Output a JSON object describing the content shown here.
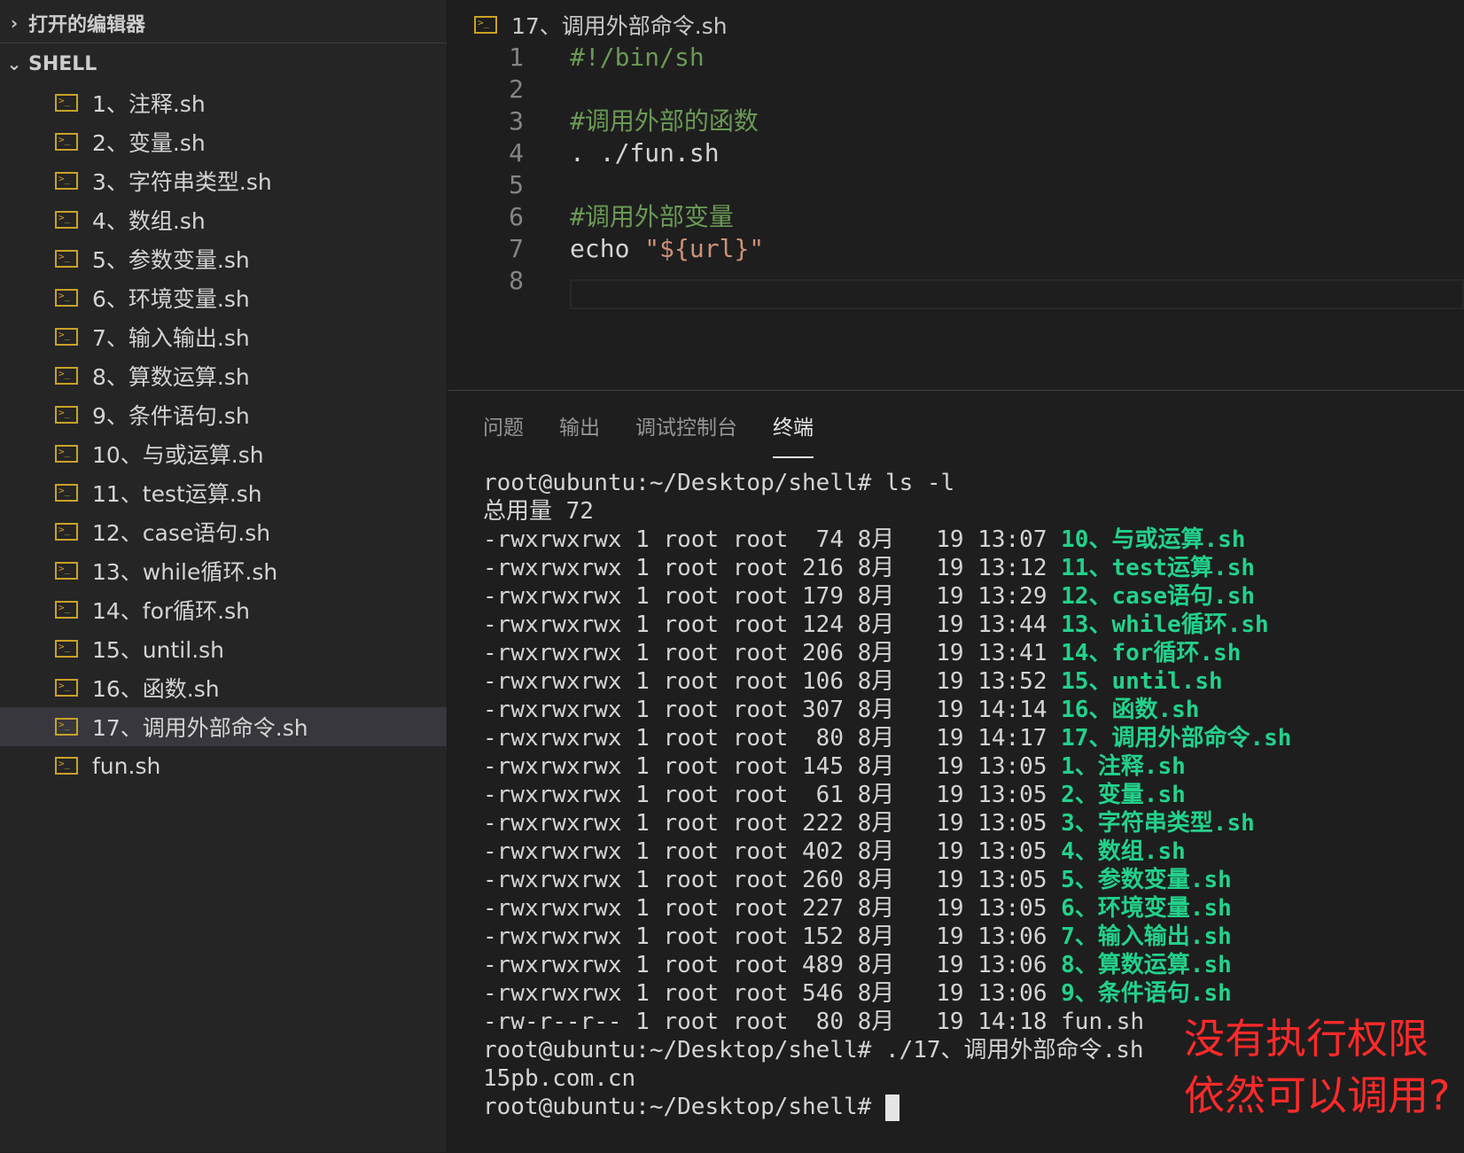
{
  "sidebar": {
    "open_editors_label": "打开的编辑器",
    "folder_label": "SHELL",
    "files": [
      {
        "name": "1、注释.sh"
      },
      {
        "name": "2、变量.sh"
      },
      {
        "name": "3、字符串类型.sh"
      },
      {
        "name": "4、数组.sh"
      },
      {
        "name": "5、参数变量.sh"
      },
      {
        "name": "6、环境变量.sh"
      },
      {
        "name": "7、输入输出.sh"
      },
      {
        "name": "8、算数运算.sh"
      },
      {
        "name": "9、条件语句.sh"
      },
      {
        "name": "10、与或运算.sh"
      },
      {
        "name": "11、test运算.sh"
      },
      {
        "name": "12、case语句.sh"
      },
      {
        "name": "13、while循环.sh"
      },
      {
        "name": "14、for循环.sh"
      },
      {
        "name": "15、until.sh"
      },
      {
        "name": "16、函数.sh"
      },
      {
        "name": "17、调用外部命令.sh",
        "active": true
      },
      {
        "name": "fun.sh"
      }
    ]
  },
  "editor": {
    "breadcrumb": "17、调用外部命令.sh",
    "lines": [
      {
        "num": "1",
        "text": "#!/bin/sh",
        "kind": "cmt"
      },
      {
        "num": "2",
        "text": "",
        "kind": "plain"
      },
      {
        "num": "3",
        "text": "#调用外部的函数",
        "kind": "cmt"
      },
      {
        "num": "4",
        "text": ". ./fun.sh",
        "kind": "plain"
      },
      {
        "num": "5",
        "text": "",
        "kind": "plain"
      },
      {
        "num": "6",
        "text": "#调用外部变量",
        "kind": "cmt"
      },
      {
        "num": "7",
        "text": "echo ",
        "kind": "plain",
        "str": "\"${url}\""
      },
      {
        "num": "8",
        "text": "",
        "kind": "plain"
      }
    ]
  },
  "panel": {
    "tabs": [
      {
        "label": "问题",
        "active": false
      },
      {
        "label": "输出",
        "active": false
      },
      {
        "label": "调试控制台",
        "active": false
      },
      {
        "label": "终端",
        "active": true
      }
    ],
    "terminal": [
      {
        "text": "root@ubuntu:~/Desktop/shell# ls -l",
        "file": ""
      },
      {
        "text": "总用量 72",
        "file": ""
      },
      {
        "text": "-rwxrwxrwx 1 root root  74 8月   19 13:07 ",
        "file": "10、与或运算.sh"
      },
      {
        "text": "-rwxrwxrwx 1 root root 216 8月   19 13:12 ",
        "file": "11、test运算.sh"
      },
      {
        "text": "-rwxrwxrwx 1 root root 179 8月   19 13:29 ",
        "file": "12、case语句.sh"
      },
      {
        "text": "-rwxrwxrwx 1 root root 124 8月   19 13:44 ",
        "file": "13、while循环.sh"
      },
      {
        "text": "-rwxrwxrwx 1 root root 206 8月   19 13:41 ",
        "file": "14、for循环.sh"
      },
      {
        "text": "-rwxrwxrwx 1 root root 106 8月   19 13:52 ",
        "file": "15、until.sh"
      },
      {
        "text": "-rwxrwxrwx 1 root root 307 8月   19 14:14 ",
        "file": "16、函数.sh"
      },
      {
        "text": "-rwxrwxrwx 1 root root  80 8月   19 14:17 ",
        "file": "17、调用外部命令.sh"
      },
      {
        "text": "-rwxrwxrwx 1 root root 145 8月   19 13:05 ",
        "file": "1、注释.sh"
      },
      {
        "text": "-rwxrwxrwx 1 root root  61 8月   19 13:05 ",
        "file": "2、变量.sh"
      },
      {
        "text": "-rwxrwxrwx 1 root root 222 8月   19 13:05 ",
        "file": "3、字符串类型.sh"
      },
      {
        "text": "-rwxrwxrwx 1 root root 402 8月   19 13:05 ",
        "file": "4、数组.sh"
      },
      {
        "text": "-rwxrwxrwx 1 root root 260 8月   19 13:05 ",
        "file": "5、参数变量.sh"
      },
      {
        "text": "-rwxrwxrwx 1 root root 227 8月   19 13:05 ",
        "file": "6、环境变量.sh"
      },
      {
        "text": "-rwxrwxrwx 1 root root 152 8月   19 13:06 ",
        "file": "7、输入输出.sh"
      },
      {
        "text": "-rwxrwxrwx 1 root root 489 8月   19 13:06 ",
        "file": "8、算数运算.sh"
      },
      {
        "text": "-rwxrwxrwx 1 root root 546 8月   19 13:06 ",
        "file": "9、条件语句.sh"
      },
      {
        "text": "-rw-r--r-- 1 root root  80 8月   19 14:18 fun.sh",
        "file": ""
      },
      {
        "text": "root@ubuntu:~/Desktop/shell# ./17、调用外部命令.sh",
        "file": ""
      },
      {
        "text": "15pb.com.cn",
        "file": ""
      },
      {
        "text": "root@ubuntu:~/Desktop/shell# ",
        "file": "",
        "cursor": true
      }
    ]
  },
  "annotation": {
    "line1": "没有执行权限",
    "line2": "依然可以调用?"
  },
  "colors": {
    "exec_file": "#23d18b",
    "comment": "#6a9955",
    "string": "#ce9178",
    "annotation": "#ff2a2a",
    "shell_icon": "#c9a227"
  }
}
